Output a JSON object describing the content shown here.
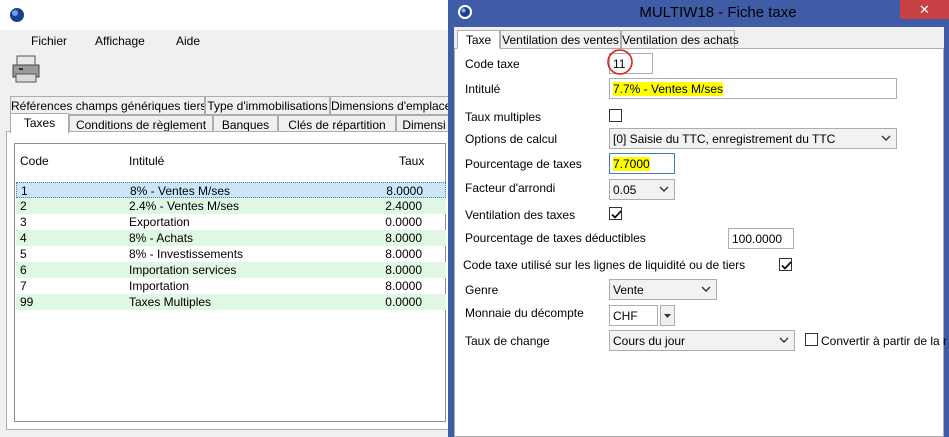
{
  "back": {
    "menu": [
      "Fichier",
      "Affichage",
      "Aide"
    ],
    "tabs_row1": [
      "Références champs génériques tiers",
      "Type d'immobilisations",
      "Dimensions d'emplacement"
    ],
    "tabs_row2": [
      "Taxes",
      "Conditions de règlement",
      "Banques",
      "Clés de répartition",
      "Dimensi"
    ],
    "table": {
      "headers": [
        "Code",
        "Intitulé",
        "Taux"
      ],
      "rows": [
        [
          "1",
          "8%  -  Ventes M/ses",
          "8.0000"
        ],
        [
          "2",
          "2.4% - Ventes M/ses",
          "2.4000"
        ],
        [
          "3",
          "Exportation",
          "0.0000"
        ],
        [
          "4",
          "8% - Achats",
          "8.0000"
        ],
        [
          "5",
          "8% - Investissements",
          "8.0000"
        ],
        [
          "6",
          "Importation services",
          "8.0000"
        ],
        [
          "7",
          "Importation",
          "8.0000"
        ],
        [
          "99",
          "Taxes Multiples",
          "0.0000"
        ]
      ]
    }
  },
  "front": {
    "title": "MULTIW18 - Fiche taxe",
    "close": "✕",
    "tabs": [
      "Taxe",
      "Ventilation des ventes",
      "Ventilation des achats"
    ],
    "fields": {
      "code_label": "Code taxe",
      "code_value": "11",
      "intitule_label": "Intitulé",
      "intitule_value": "7.7%  -  Ventes M/ses",
      "taux_multiples_label": "Taux multiples",
      "options_label": "Options de calcul",
      "options_value": "[0] Saisie du TTC, enregistrement du TTC",
      "pourcentage_label": "Pourcentage de taxes",
      "pourcentage_value": "7.7000",
      "arrondi_label": "Facteur d'arrondi",
      "arrondi_value": "0.05",
      "ventilation_label": "Ventilation des taxes",
      "deductibles_label": "Pourcentage de taxes déductibles",
      "deductibles_value": "100.0000",
      "liquidite_label": "Code taxe utilisé sur les lignes de liquidité ou de tiers",
      "genre_label": "Genre",
      "genre_value": "Vente",
      "monnaie_label": "Monnaie du décompte",
      "monnaie_value": "CHF",
      "change_label": "Taux de change",
      "change_value": "Cours du jour",
      "convertir_label": "Convertir à partir de la r"
    }
  },
  "colors": {
    "title_bar_active": "#3f5da7",
    "row_alt": "#dff7e3",
    "row_selected": "#cce6f7",
    "highlight": "#ffff00",
    "annotation_circle": "#e02020"
  }
}
